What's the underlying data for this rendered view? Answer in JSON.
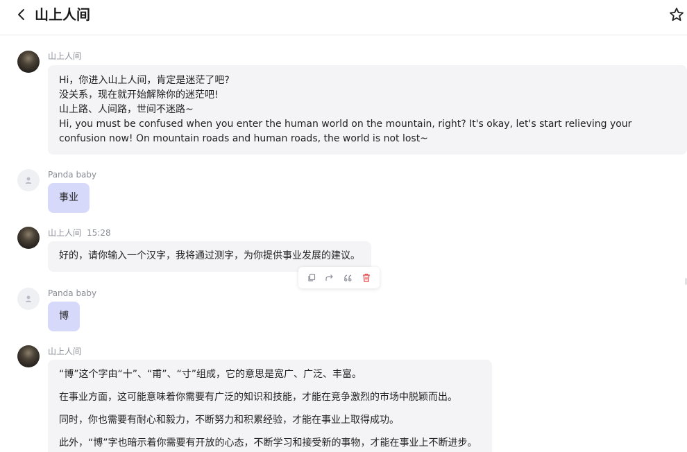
{
  "header": {
    "title": "山上人间",
    "back_icon": "chevron-left-icon",
    "star_icon": "star-outline-icon"
  },
  "messages": [
    {
      "sender": "山上人间",
      "time": "",
      "lines": [
        "Hi，你进入山上人间，肯定是迷茫了吧?",
        "没关系，现在就开始解除你的迷茫吧!",
        "山上路、人间路，世间不迷路~",
        "Hi, you must be confused when you enter the human world on the mountain, right? It's okay, let's start relieving your confusion now! On mountain roads and human roads, the world is not lost~"
      ]
    },
    {
      "sender": "Panda baby",
      "text": "事业"
    },
    {
      "sender": "山上人间",
      "time": "15:28",
      "text": "好的，请你输入一个汉字，我将通过测字，为你提供事业发展的建议。"
    },
    {
      "sender": "Panda baby",
      "text": "博"
    },
    {
      "sender": "山上人间",
      "time": "",
      "paragraphs": [
        "“博”这个字由“十”、“甫”、“寸”组成，它的意思是宽广、广泛、丰富。",
        "在事业方面，这可能意味着你需要有广泛的知识和技能，才能在竞争激烈的市场中脱颖而出。",
        "同时，你也需要有耐心和毅力，不断努力和积累经验，才能在事业上取得成功。",
        "此外，“博”字也暗示着你需要有开放的心态，不断学习和接受新的事物，才能在事业上不断进步。"
      ]
    }
  ],
  "toolbar": {
    "icons": [
      "copy-icon",
      "share-icon",
      "quote-icon",
      "delete-icon"
    ],
    "delete_color": "#e5484d"
  },
  "colors": {
    "user_bubble": "#d7d9fb",
    "bot_bubble": "#f4f4f6"
  }
}
